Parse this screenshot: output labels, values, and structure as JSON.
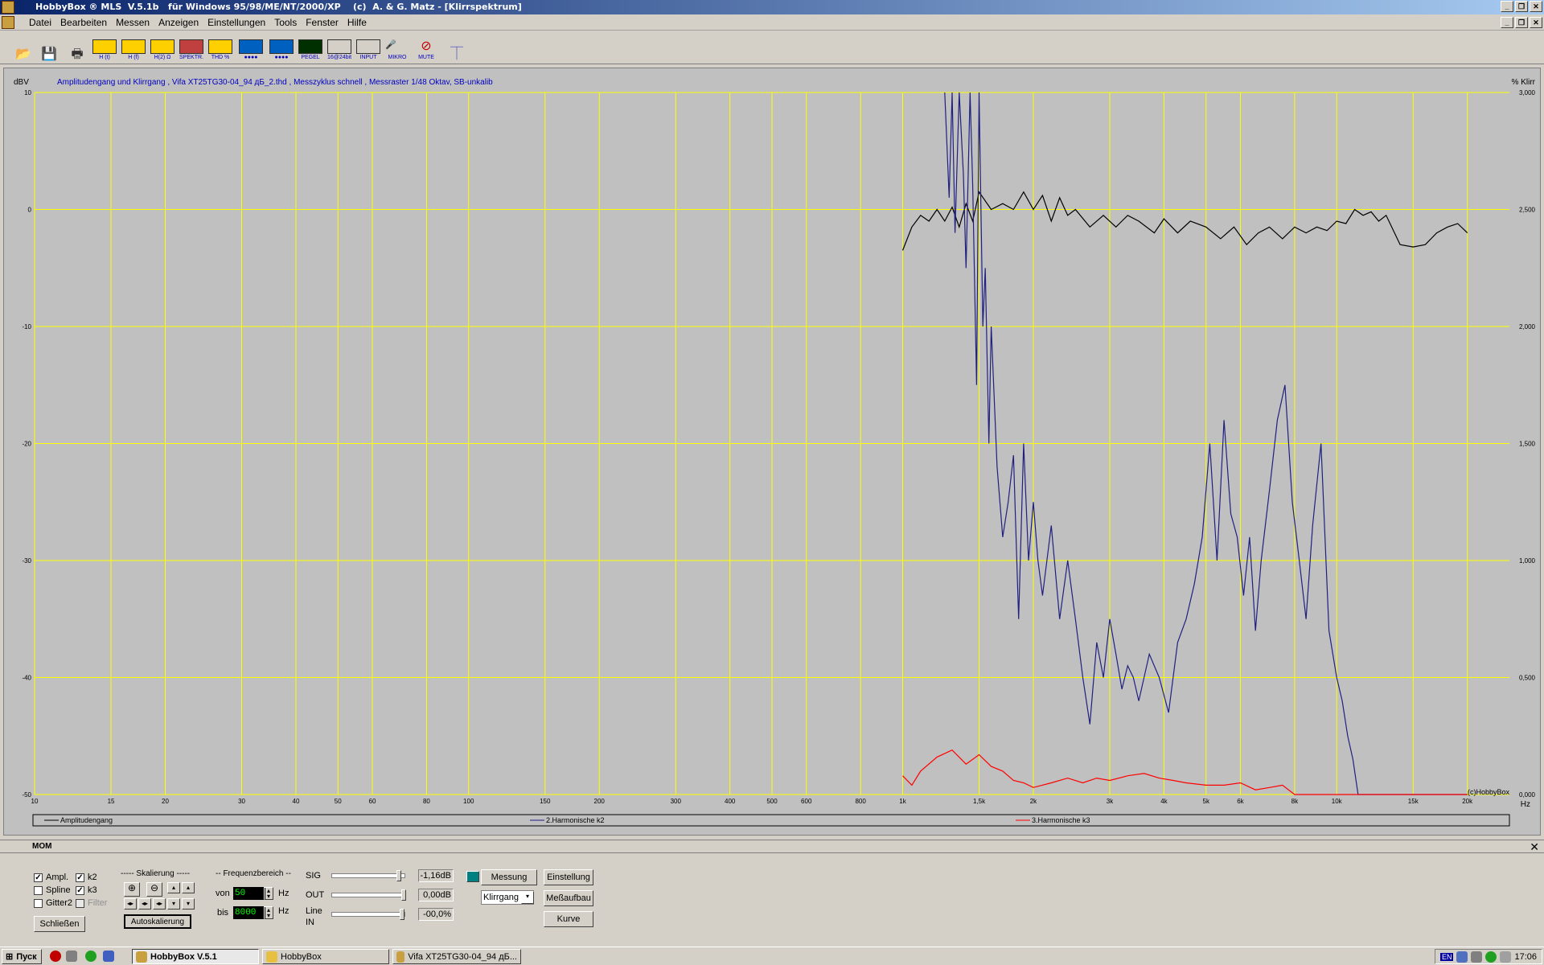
{
  "window": {
    "title": "HobbyBox ® MLS  V.5.1b   für Windows 95/98/ME/NT/2000/XP    (c)  A. & G. Matz - [Klirrspektrum]"
  },
  "menu": [
    "Datei",
    "Bearbeiten",
    "Messen",
    "Anzeigen",
    "Einstellungen",
    "Tools",
    "Fenster",
    "Hilfe"
  ],
  "toolbar": [
    {
      "name": "open",
      "label": ""
    },
    {
      "name": "save",
      "label": ""
    },
    {
      "name": "print",
      "label": ""
    },
    {
      "name": "ht",
      "label": "H (t)"
    },
    {
      "name": "hf",
      "label": "H (f)"
    },
    {
      "name": "hfohm",
      "label": "H(2) Ω"
    },
    {
      "name": "spektr",
      "label": "SPEKTR."
    },
    {
      "name": "thd",
      "label": "THD %"
    },
    {
      "name": "scope",
      "label": "●●●●"
    },
    {
      "name": "bars",
      "label": "●●●●"
    },
    {
      "name": "pegel",
      "label": "PEGEL"
    },
    {
      "name": "bit16",
      "label": "16@24bit"
    },
    {
      "name": "input",
      "label": "INPUT"
    },
    {
      "name": "mikro",
      "label": "MIKRO"
    },
    {
      "name": "mute",
      "label": "MUTE"
    },
    {
      "name": "probe",
      "label": ""
    }
  ],
  "chart_data": {
    "type": "line",
    "title": "Amplitudengang und Klirrgang , Vifa XT25TG30-04_94 дБ_2.thd , Messzyklus schnell , Messraster 1/48 Oktav, SB-unkalib",
    "ylabel": "dBV",
    "y2label": "% Klirr",
    "xlabel": "Hz",
    "xscale": "log",
    "xlim": [
      10,
      25000
    ],
    "ylim": [
      -50,
      10
    ],
    "y2lim": [
      0,
      3
    ],
    "xticks": [
      {
        "v": 10,
        "t": "10"
      },
      {
        "v": 15,
        "t": "15"
      },
      {
        "v": 20,
        "t": "20"
      },
      {
        "v": 30,
        "t": "30"
      },
      {
        "v": 40,
        "t": "40"
      },
      {
        "v": 50,
        "t": "50"
      },
      {
        "v": 60,
        "t": "60"
      },
      {
        "v": 80,
        "t": "80"
      },
      {
        "v": 100,
        "t": "100"
      },
      {
        "v": 150,
        "t": "150"
      },
      {
        "v": 200,
        "t": "200"
      },
      {
        "v": 300,
        "t": "300"
      },
      {
        "v": 400,
        "t": "400"
      },
      {
        "v": 500,
        "t": "500"
      },
      {
        "v": 600,
        "t": "600"
      },
      {
        "v": 800,
        "t": "800"
      },
      {
        "v": 1000,
        "t": "1k"
      },
      {
        "v": 1500,
        "t": "1,5k"
      },
      {
        "v": 2000,
        "t": "2k"
      },
      {
        "v": 3000,
        "t": "3k"
      },
      {
        "v": 4000,
        "t": "4k"
      },
      {
        "v": 5000,
        "t": "5k"
      },
      {
        "v": 6000,
        "t": "6k"
      },
      {
        "v": 8000,
        "t": "8k"
      },
      {
        "v": 10000,
        "t": "10k"
      },
      {
        "v": 15000,
        "t": "15k"
      },
      {
        "v": 20000,
        "t": "20k"
      }
    ],
    "yticks": [
      {
        "v": 10,
        "t": "10"
      },
      {
        "v": 0,
        "t": "0"
      },
      {
        "v": -10,
        "t": "-10"
      },
      {
        "v": -20,
        "t": "-20"
      },
      {
        "v": -30,
        "t": "-30"
      },
      {
        "v": -40,
        "t": "-40"
      },
      {
        "v": -50,
        "t": "-50"
      }
    ],
    "y2ticks": [
      "3,000",
      "2,500",
      "2,000",
      "1,500",
      "1,000",
      "0,500",
      "0,000"
    ],
    "watermark": "(c)HobbyBox",
    "grid": true,
    "grid_color": "#ffff00",
    "background": "#c0c0c0",
    "series": [
      {
        "name": "Amplitudengang",
        "color": "#000000",
        "x": [
          1000,
          1050,
          1100,
          1150,
          1200,
          1250,
          1300,
          1350,
          1400,
          1450,
          1500,
          1600,
          1700,
          1800,
          1900,
          2000,
          2100,
          2200,
          2300,
          2400,
          2500,
          2700,
          2900,
          3100,
          3300,
          3500,
          3800,
          4000,
          4300,
          4600,
          5000,
          5400,
          5800,
          6200,
          6600,
          7000,
          7500,
          8000,
          8500,
          9000,
          9500,
          10000,
          10500,
          11000,
          11500,
          12000,
          12500,
          13000,
          14000,
          15000,
          16000,
          17000,
          18000,
          19000,
          20000
        ],
        "y": [
          -3.5,
          -1.5,
          -0.5,
          -1.0,
          0.0,
          -1.0,
          0.2,
          -1.5,
          0.5,
          -1.0,
          1.5,
          0.0,
          0.5,
          0.0,
          1.5,
          0.0,
          1.2,
          -1.0,
          1.0,
          -0.5,
          0.0,
          -1.5,
          -0.5,
          -1.5,
          -0.5,
          -1.0,
          -2.0,
          -0.8,
          -2.0,
          -1.0,
          -1.5,
          -2.5,
          -1.5,
          -3.0,
          -2.0,
          -1.5,
          -2.5,
          -1.5,
          -2.0,
          -1.5,
          -1.8,
          -1.0,
          -1.2,
          0.0,
          -0.5,
          -0.2,
          -1.0,
          -0.5,
          -3.0,
          -3.2,
          -3.0,
          -2.0,
          -1.5,
          -1.2,
          -2.0
        ]
      },
      {
        "name": "2.Harmonische k2",
        "color": "#202080",
        "x": [
          1250,
          1280,
          1300,
          1320,
          1350,
          1380,
          1400,
          1430,
          1450,
          1480,
          1500,
          1530,
          1550,
          1580,
          1600,
          1650,
          1700,
          1750,
          1800,
          1850,
          1900,
          1950,
          2000,
          2050,
          2100,
          2200,
          2300,
          2400,
          2500,
          2600,
          2700,
          2800,
          2900,
          3000,
          3100,
          3200,
          3300,
          3400,
          3500,
          3700,
          3900,
          4100,
          4300,
          4500,
          4700,
          4900,
          5100,
          5300,
          5500,
          5700,
          5900,
          6100,
          6300,
          6500,
          6700,
          7000,
          7300,
          7600,
          7900,
          8200,
          8500,
          8800,
          9200,
          9600,
          10000,
          10300,
          10600,
          10900,
          11200,
          11500,
          11800,
          12000,
          20000
        ],
        "y": [
          10,
          1,
          10,
          -2,
          10,
          3,
          -5,
          10,
          2,
          -15,
          10,
          -10,
          -5,
          -20,
          -10,
          -22,
          -28,
          -25,
          -21,
          -35,
          -20,
          -30,
          -25,
          -30,
          -33,
          -27,
          -35,
          -30,
          -35,
          -40,
          -44,
          -37,
          -40,
          -35,
          -38,
          -41,
          -39,
          -40,
          -42,
          -38,
          -40,
          -43,
          -37,
          -35,
          -32,
          -28,
          -20,
          -30,
          -18,
          -26,
          -28,
          -33,
          -28,
          -36,
          -30,
          -24,
          -18,
          -15,
          -25,
          -30,
          -35,
          -27,
          -20,
          -36,
          -40,
          -42,
          -45,
          -47,
          -50,
          -50,
          -50,
          -50,
          -50
        ]
      },
      {
        "name": "3.Harmonische k3",
        "color": "#ff0000",
        "x": [
          1000,
          1050,
          1100,
          1200,
          1300,
          1400,
          1500,
          1600,
          1700,
          1800,
          1900,
          2000,
          2200,
          2400,
          2600,
          2800,
          3000,
          3300,
          3600,
          3900,
          4200,
          4500,
          5000,
          5500,
          6000,
          6500,
          7000,
          7500,
          8000,
          9000,
          10000,
          12000,
          15000,
          20000
        ],
        "y": [
          0.08,
          0.04,
          0.1,
          0.16,
          0.19,
          0.13,
          0.17,
          0.12,
          0.1,
          0.06,
          0.05,
          0.03,
          0.05,
          0.07,
          0.05,
          0.07,
          0.06,
          0.08,
          0.09,
          0.07,
          0.06,
          0.05,
          0.04,
          0.04,
          0.05,
          0.02,
          0.03,
          0.04,
          0.0,
          0.0,
          0.0,
          0.0,
          0.0,
          0.0
        ]
      }
    ]
  },
  "legend": [
    "Amplitudengang",
    "2.Harmonische k2",
    "3.Harmonische k3"
  ],
  "panel": {
    "header": "МОМ",
    "checks": {
      "ampl": "Ampl.",
      "k2": "k2",
      "spline": "Spline",
      "k3": "k3",
      "gitter2": "Gitter2",
      "filter": "Filter"
    },
    "schliessen": "Schließen",
    "skalierung_title": "----- Skalierung -----",
    "autoskalierung": "Autoskalierung",
    "freq_title": "-- Frequenzbereich --",
    "von_label": "von",
    "von_value": "50",
    "bis_label": "bis",
    "bis_value": "8000",
    "hz": "Hz",
    "sig_label": "SIG",
    "sig_value": "-1,16dB",
    "out_label": "OUT",
    "out_value": "0,00dB",
    "line_label": "Line",
    "in_label": "IN",
    "line_value": "-00,0%",
    "messung": "Messung",
    "einstellung": "Einstellung",
    "messaufbau": "Meßaufbau",
    "kurve": "Kurve",
    "select_value": "Klirrgang"
  },
  "taskbar": {
    "start": "Пуск",
    "buttons": [
      "HobbyBox V.5.1",
      "HobbyBox",
      "Vifa XT25TG30-04_94 дБ..."
    ],
    "lang": "EN",
    "clock": "17:06"
  }
}
